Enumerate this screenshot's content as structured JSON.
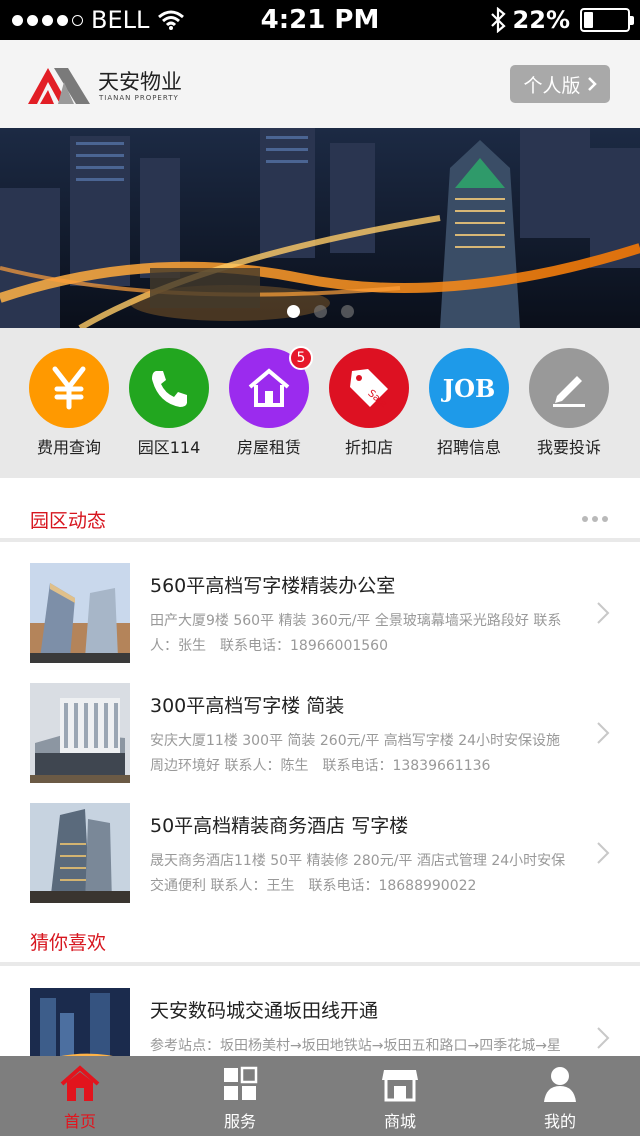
{
  "status_bar": {
    "carrier": "BELL",
    "time": "4:21 PM",
    "battery": "22%",
    "battery_level": 0.22,
    "signal_bars": 4
  },
  "header": {
    "brand_name": "天安物业",
    "brand_en": "TIANAN PROPERTY",
    "personal_button": "个人版",
    "brand_color": "#e21e25"
  },
  "banner": {
    "slide_count": 3,
    "active_slide": 1
  },
  "quick_menu": [
    {
      "label": "费用查询",
      "icon": "yen-icon",
      "color": "#ff9900"
    },
    {
      "label": "园区114",
      "icon": "phone-icon",
      "color": "#22a61f"
    },
    {
      "label": "房屋租赁",
      "icon": "house-icon",
      "color": "#9b2bee",
      "badge": "5"
    },
    {
      "label": "折扣店",
      "icon": "sale-tag-icon",
      "color": "#dd1122"
    },
    {
      "label": "招聘信息",
      "icon": "job-icon",
      "color": "#1e9ae9",
      "icon_text": "JOB"
    },
    {
      "label": "我要投诉",
      "icon": "pencil-icon",
      "color": "#999999"
    }
  ],
  "section_news": {
    "title": "园区动态",
    "items": [
      {
        "title": "560平高档写字楼精装办公室",
        "desc": "田产大厦9楼 560平 精装 360元/平 全景玻璃幕墙采光路段好 联系人：张生　联系电话：18966001560"
      },
      {
        "title": "300平高档写字楼 简装",
        "desc": "安庆大厦11楼 300平 简装 260元/平 高档写字楼 24小时安保设施 周边环境好 联系人：陈生　联系电话：13839661136"
      },
      {
        "title": "50平高档精装商务酒店 写字楼",
        "desc": "晟天商务酒店11楼 50平 精装修 280元/平 酒店式管理 24小时安保 交通便利 联系人：王生　联系电话：18688990022"
      }
    ]
  },
  "section_guess": {
    "title": "猜你喜欢",
    "items": [
      {
        "title": "天安数码城交通坂田线开通",
        "desc": "参考站点：坂田杨美村→坂田地铁站→坂田五和路口→四季花城→星"
      }
    ]
  },
  "tabbar": {
    "tabs": [
      {
        "label": "首页",
        "icon": "home-icon",
        "active": true
      },
      {
        "label": "服务",
        "icon": "grid-icon",
        "active": false
      },
      {
        "label": "商城",
        "icon": "store-icon",
        "active": false
      },
      {
        "label": "我的",
        "icon": "user-icon",
        "active": false
      }
    ],
    "active_color": "#e2141d"
  }
}
